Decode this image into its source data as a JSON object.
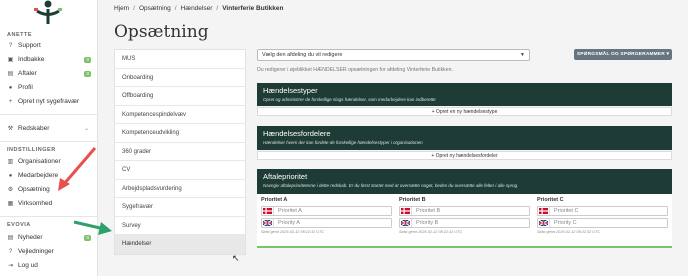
{
  "sidebar": {
    "section_anette": "ANETTE",
    "items_anette": [
      {
        "label": "Support",
        "icon": "question-icon"
      },
      {
        "label": "Indbakke",
        "icon": "inbox-icon",
        "badge": "0"
      },
      {
        "label": "Aftaler",
        "icon": "calendar-icon",
        "badge": "0"
      },
      {
        "label": "Profil",
        "icon": "user-icon"
      },
      {
        "label": "Opret nyt sygefravær",
        "icon": "plus-icon"
      }
    ],
    "redskaber": {
      "label": "Redskaber",
      "icon": "tools-icon"
    },
    "section_indstillinger": "INDSTILLINGER",
    "items_indstillinger": [
      {
        "label": "Organisationer",
        "icon": "building-icon"
      },
      {
        "label": "Medarbejdere",
        "icon": "users-icon"
      },
      {
        "label": "Opsætning",
        "icon": "gear-icon"
      },
      {
        "label": "Virksomhed",
        "icon": "office-icon"
      }
    ],
    "section_evovia": "EVOVIA",
    "items_evovia": [
      {
        "label": "Nyheder",
        "icon": "news-icon",
        "badge": "0"
      },
      {
        "label": "Vejledninger",
        "icon": "question-icon"
      },
      {
        "label": "Log ud",
        "icon": "logout-icon"
      }
    ]
  },
  "breadcrumb": [
    "Hjem",
    "Opsætning",
    "Hændelser",
    "Vinterferie Butikken"
  ],
  "page_title": "Opsætning",
  "departments": [
    "MUS",
    "Onboarding",
    "Offboarding",
    "Kompetencespindelvæv",
    "Kompetenceudvikling",
    "360 grader",
    "CV",
    "Arbejdspladsvurdering",
    "Sygefravær",
    "Survey",
    "Hændelser"
  ],
  "active_department": "Hændelser",
  "select": {
    "value": "Vælg den afdeling du vil redigere"
  },
  "info_text": "Du redigerer i øjeblikket HÆNDELSER opsætningen for afdeling Vinterferie Butikken.",
  "survey_button": "SPØRGSMÅL OG SPØRGERAMMER",
  "panels": {
    "types": {
      "title": "Hændelsestyper",
      "subtitle": "Opret og administrer de forskellige slags hændelser, som medarbejdere kan indberette",
      "button": "+ Opret en ny hændelsestype"
    },
    "distributors": {
      "title": "Hændelsesfordelere",
      "subtitle": "Hændelser hvem der kan fordele de forskellige hændelsestyper i organisationen",
      "button": "+ Opret ny hændelsesfordeler"
    },
    "priority": {
      "title": "Aftaleprioritet",
      "subtitle": "Navngiv aftaleprioriteterne i dette redskab. Er du først startet med at oversætte noget, bedes du oversætte alle felter i alle sprog.",
      "columns": [
        {
          "label": "Prioritet A",
          "da_placeholder": "Prioritet A",
          "en_placeholder": "Priority A",
          "saved": "Sidst gemt 2025-02-12 08:22:32 UTC"
        },
        {
          "label": "Prioritet B",
          "da_placeholder": "Prioritet B",
          "en_placeholder": "Priority B",
          "saved": "Sidst gemt 2025-02-12 08:22:32 UTC"
        },
        {
          "label": "Prioritet C",
          "da_placeholder": "Prioritet C",
          "en_placeholder": "Priority C",
          "saved": "Sidst gemt 2025-02-12 08:22:32 UTC"
        }
      ]
    }
  },
  "colors": {
    "sidebar_bg": "#ffffff",
    "panel_dark": "#1e3b35",
    "accent_green": "#7cc26a",
    "arrow_red": "#e8504f",
    "arrow_green": "#2ea06a",
    "button_slate": "#667680"
  }
}
